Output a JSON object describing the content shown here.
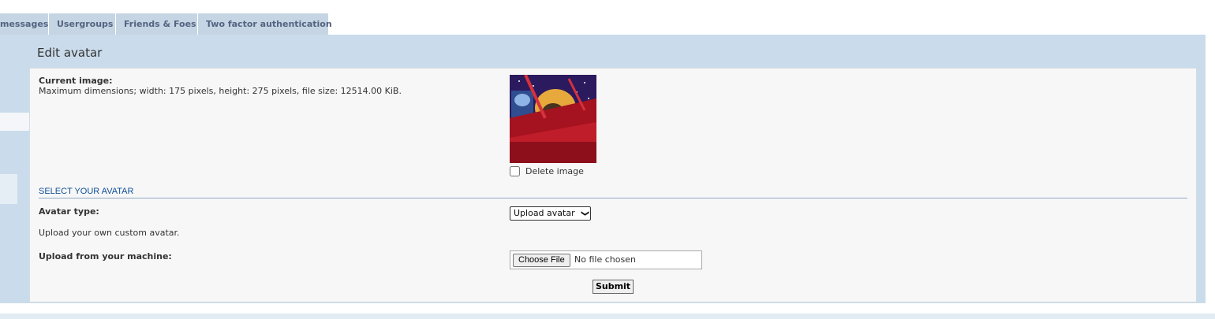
{
  "tabs": [
    {
      "label": "messages"
    },
    {
      "label": "Usergroups"
    },
    {
      "label": "Friends & Foes"
    },
    {
      "label": "Two factor authentication"
    }
  ],
  "panel": {
    "title": "Edit avatar"
  },
  "current_image": {
    "label": "Current image:",
    "description": "Maximum dimensions; width: 175 pixels, height: 275 pixels, file size: 12514.00 KiB.",
    "delete_label": "Delete image",
    "delete_checked": false
  },
  "select_section": {
    "heading": "SELECT YOUR AVATAR",
    "avatar_type_label": "Avatar type:",
    "avatar_type_value": "Upload avatar",
    "upload_description": "Upload your own custom avatar.",
    "upload_label": "Upload from your machine:",
    "choose_file_label": "Choose File",
    "no_file_text": "No file chosen"
  },
  "submit_label": "Submit",
  "colors": {
    "tab_bg": "#c6d5e3",
    "tab_text": "#536482",
    "panel_bg": "#cadceb",
    "content_bg": "#f7f7f7",
    "section_heading": "#115098"
  }
}
